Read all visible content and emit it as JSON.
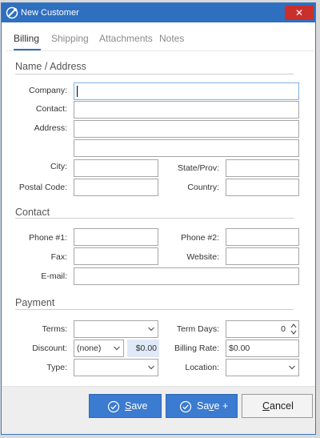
{
  "window": {
    "title": "New Customer",
    "close_glyph": "✕"
  },
  "tabs": [
    {
      "label": "Billing",
      "active": true
    },
    {
      "label": "Shipping",
      "active": false
    },
    {
      "label": "Attachments",
      "active": false
    },
    {
      "label": "Notes",
      "active": false
    }
  ],
  "sections": {
    "name_address": "Name / Address",
    "contact": "Contact",
    "payment": "Payment"
  },
  "name_address": {
    "company_label": "Company:",
    "company_value": "",
    "contact_label": "Contact:",
    "contact_value": "",
    "address_label": "Address:",
    "address_line1": "",
    "address_line2": "",
    "city_label": "City:",
    "city_value": "",
    "state_label": "State/Prov:",
    "state_value": "",
    "postal_label": "Postal Code:",
    "postal_value": "",
    "country_label": "Country:",
    "country_value": ""
  },
  "contact": {
    "phone1_label": "Phone #1:",
    "phone1_value": "",
    "phone2_label": "Phone #2:",
    "phone2_value": "",
    "fax_label": "Fax:",
    "fax_value": "",
    "website_label": "Website:",
    "website_value": "",
    "email_label": "E-mail:",
    "email_value": ""
  },
  "payment": {
    "terms_label": "Terms:",
    "terms_value": "",
    "term_days_label": "Term Days:",
    "term_days_value": "0",
    "discount_label": "Discount:",
    "discount_value": "(none)",
    "discount_amount": "$0.00",
    "billing_rate_label": "Billing Rate:",
    "billing_rate_value": "$0.00",
    "type_label": "Type:",
    "type_value": "",
    "location_label": "Location:",
    "location_value": ""
  },
  "buttons": {
    "save_first": "S",
    "save_rest": "ave",
    "saveplus_first": "Sa",
    "saveplus_u": "v",
    "saveplus_rest": "e +",
    "cancel_first": "C",
    "cancel_rest": "ancel"
  },
  "icons": {
    "app": "customer-app-icon",
    "save": "check-circle-icon",
    "save_plus": "check-circle-icon",
    "dropdown": "chevron-down-icon",
    "spinner": "spin-arrows-icon"
  },
  "colors": {
    "titlebar": "#2f6fc0",
    "close": "#c9302c",
    "accent": "#3b7bd0",
    "discount_bg": "#dfe9f7"
  }
}
